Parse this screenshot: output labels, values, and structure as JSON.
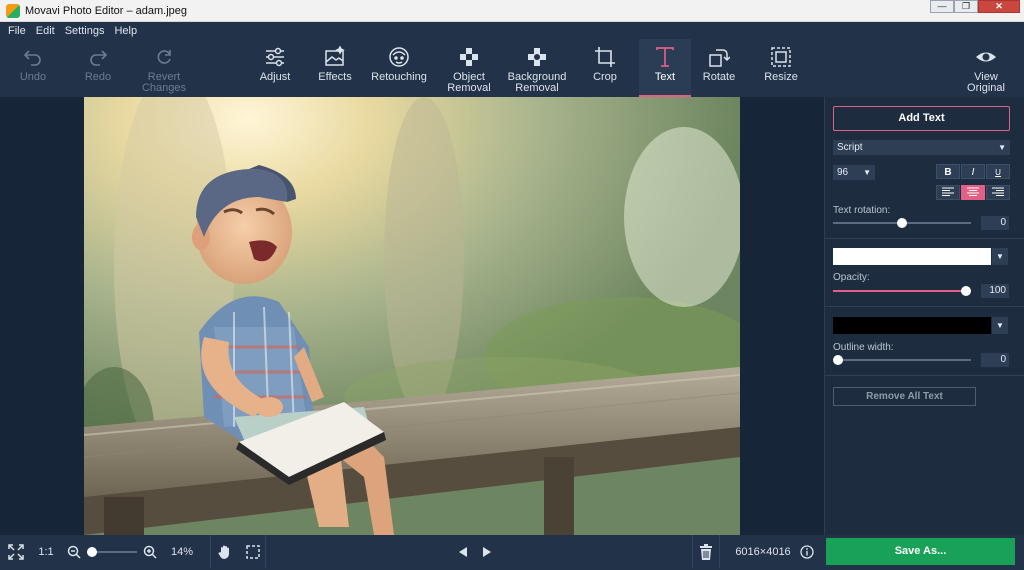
{
  "window": {
    "title": "Movavi Photo Editor – adam.jpeg"
  },
  "menu": [
    "File",
    "Edit",
    "Settings",
    "Help"
  ],
  "toolbar": {
    "undo": "Undo",
    "redo": "Redo",
    "revert": "Revert\nChanges",
    "adjust": "Adjust",
    "effects": "Effects",
    "retouching": "Retouching",
    "object_removal": "Object\nRemoval",
    "background_removal": "Background\nRemoval",
    "crop": "Crop",
    "text": "Text",
    "rotate": "Rotate",
    "resize": "Resize",
    "view_original": "View\nOriginal"
  },
  "panel": {
    "add_text": "Add Text",
    "font": "Script",
    "size": "96",
    "bold": "B",
    "italic": "I",
    "underline": "U",
    "text_rotation_label": "Text rotation:",
    "text_rotation_value": "0",
    "text_rotation_level": 0.5,
    "fill_color": "#ffffff",
    "opacity_label": "Opacity:",
    "opacity_value": "100",
    "opacity_level": 1.0,
    "outline_color": "#000000",
    "outline_width_label": "Outline width:",
    "outline_width_value": "0",
    "outline_level": 0.0,
    "remove_all": "Remove All Text"
  },
  "bottom": {
    "ratio": "1:1",
    "zoom": "14%",
    "dimensions": "6016×4016",
    "save": "Save As..."
  },
  "colors": {
    "accent": "#e25f86",
    "save": "#1aa158",
    "panel_bg": "#1e2c40"
  }
}
